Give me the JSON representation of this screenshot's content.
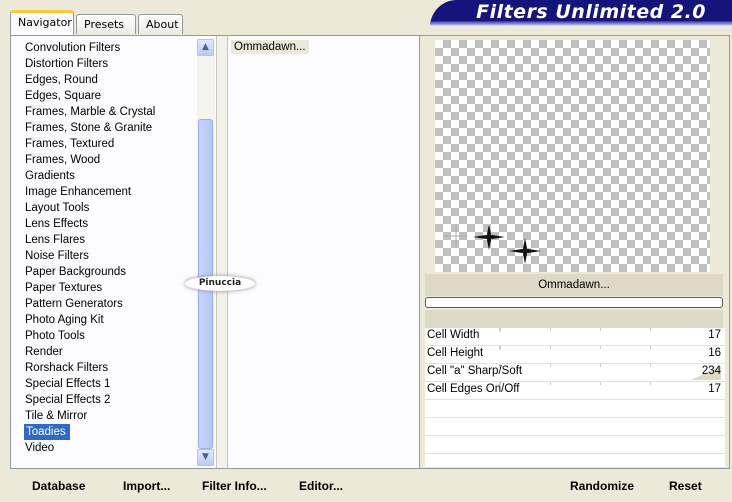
{
  "app": {
    "title": "Filters Unlimited 2.0"
  },
  "tabs": [
    {
      "label": "Navigator",
      "active": true
    },
    {
      "label": "Presets",
      "active": false
    },
    {
      "label": "About",
      "active": false
    }
  ],
  "categories": [
    "Convolution Filters",
    "Distortion Filters",
    "Edges, Round",
    "Edges, Square",
    "Frames, Marble & Crystal",
    "Frames, Stone & Granite",
    "Frames, Textured",
    "Frames, Wood",
    "Gradients",
    "Image Enhancement",
    "Layout Tools",
    "Lens Effects",
    "Lens Flares",
    "Noise Filters",
    "Paper Backgrounds",
    "Paper Textures",
    "Pattern Generators",
    "Photo Aging Kit",
    "Photo Tools",
    "Render",
    "Rorshack Filters",
    "Special Effects 1",
    "Special Effects 2",
    "Tile & Mirror",
    "Toadies",
    "Video"
  ],
  "selected_category": "Toadies",
  "filters": [
    "Ommadawn..."
  ],
  "watermark": "Pinuccia",
  "preview": {
    "filter_name": "Ommadawn..."
  },
  "parameters": [
    {
      "name": "Cell Width",
      "value": "17"
    },
    {
      "name": "Cell Height",
      "value": "16"
    },
    {
      "name": "Cell \"a\" Sharp/Soft",
      "value": "234"
    },
    {
      "name": "Cell Edges On/Off",
      "value": "17"
    }
  ],
  "buttons": {
    "database": "Database",
    "import": "Import...",
    "filter_info": "Filter Info...",
    "editor": "Editor...",
    "randomize": "Randomize",
    "reset": "Reset"
  },
  "colors": {
    "banner": "#14147a",
    "selection": "#316ac5",
    "panel_bg": "#ece9d8"
  }
}
